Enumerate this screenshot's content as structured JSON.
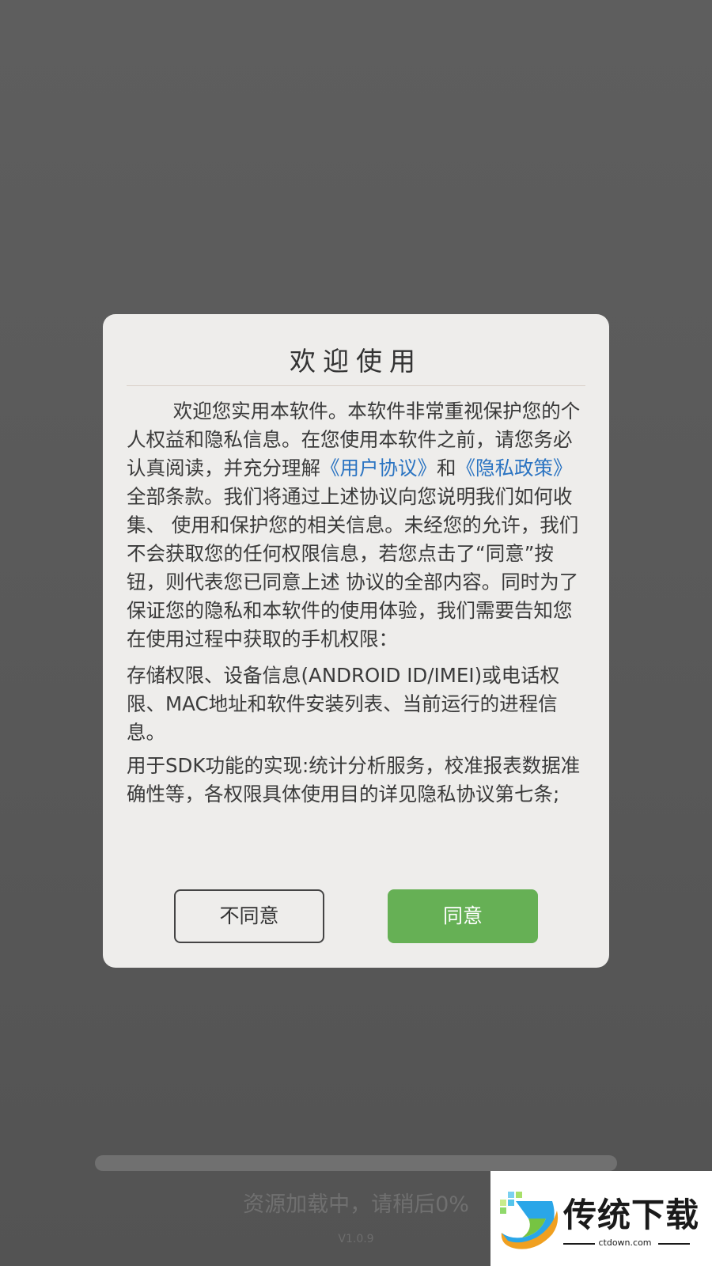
{
  "dialog": {
    "title": "欢迎使用",
    "paragraph1": {
      "before_user_agreement": "欢迎您实用本软件。本软件非常重视保护您的个人权益和隐私信息。在您使用本软件之前，请您务必认真阅读，并充分理解",
      "user_agreement_link": "《用户协议》",
      "between_links": "和",
      "privacy_policy_link": "《隐私政策》",
      "after_privacy_policy": "全部条款。我们将通过上述协议向您说明我们如何收集、 使用和保护您的相关信息。未经您的允许，我们不会获取您的任何权限信息，若您点击了“同意”按钮，则代表您已同意上述 协议的全部内容。同时为了保证您的隐私和本软件的使用体验，我们需要告知您在使用过程中获取的手机权限："
    },
    "paragraph2": "存储权限、设备信息(ANDROID ID/IMEI)或电话权限、MAC地址和软件安装列表、当前运行的进程信息。",
    "paragraph3": "用于SDK功能的实现:统计分析服务，校准报表数据准确性等，各权限具体使用目的详见隐私协议第七条;",
    "disagree_label": "不同意",
    "agree_label": "同意"
  },
  "loading": {
    "text": "资源加载中，请稍后0%",
    "progress_percent": 0,
    "version": "V1.0.9"
  },
  "watermark": {
    "title": "传统下载",
    "subtitle": "ctdown.com"
  },
  "colors": {
    "agree_green": "#66b055",
    "link_blue": "#2b74c2",
    "dialog_bg": "#eeedeb",
    "backdrop": "#5a5a5a"
  }
}
